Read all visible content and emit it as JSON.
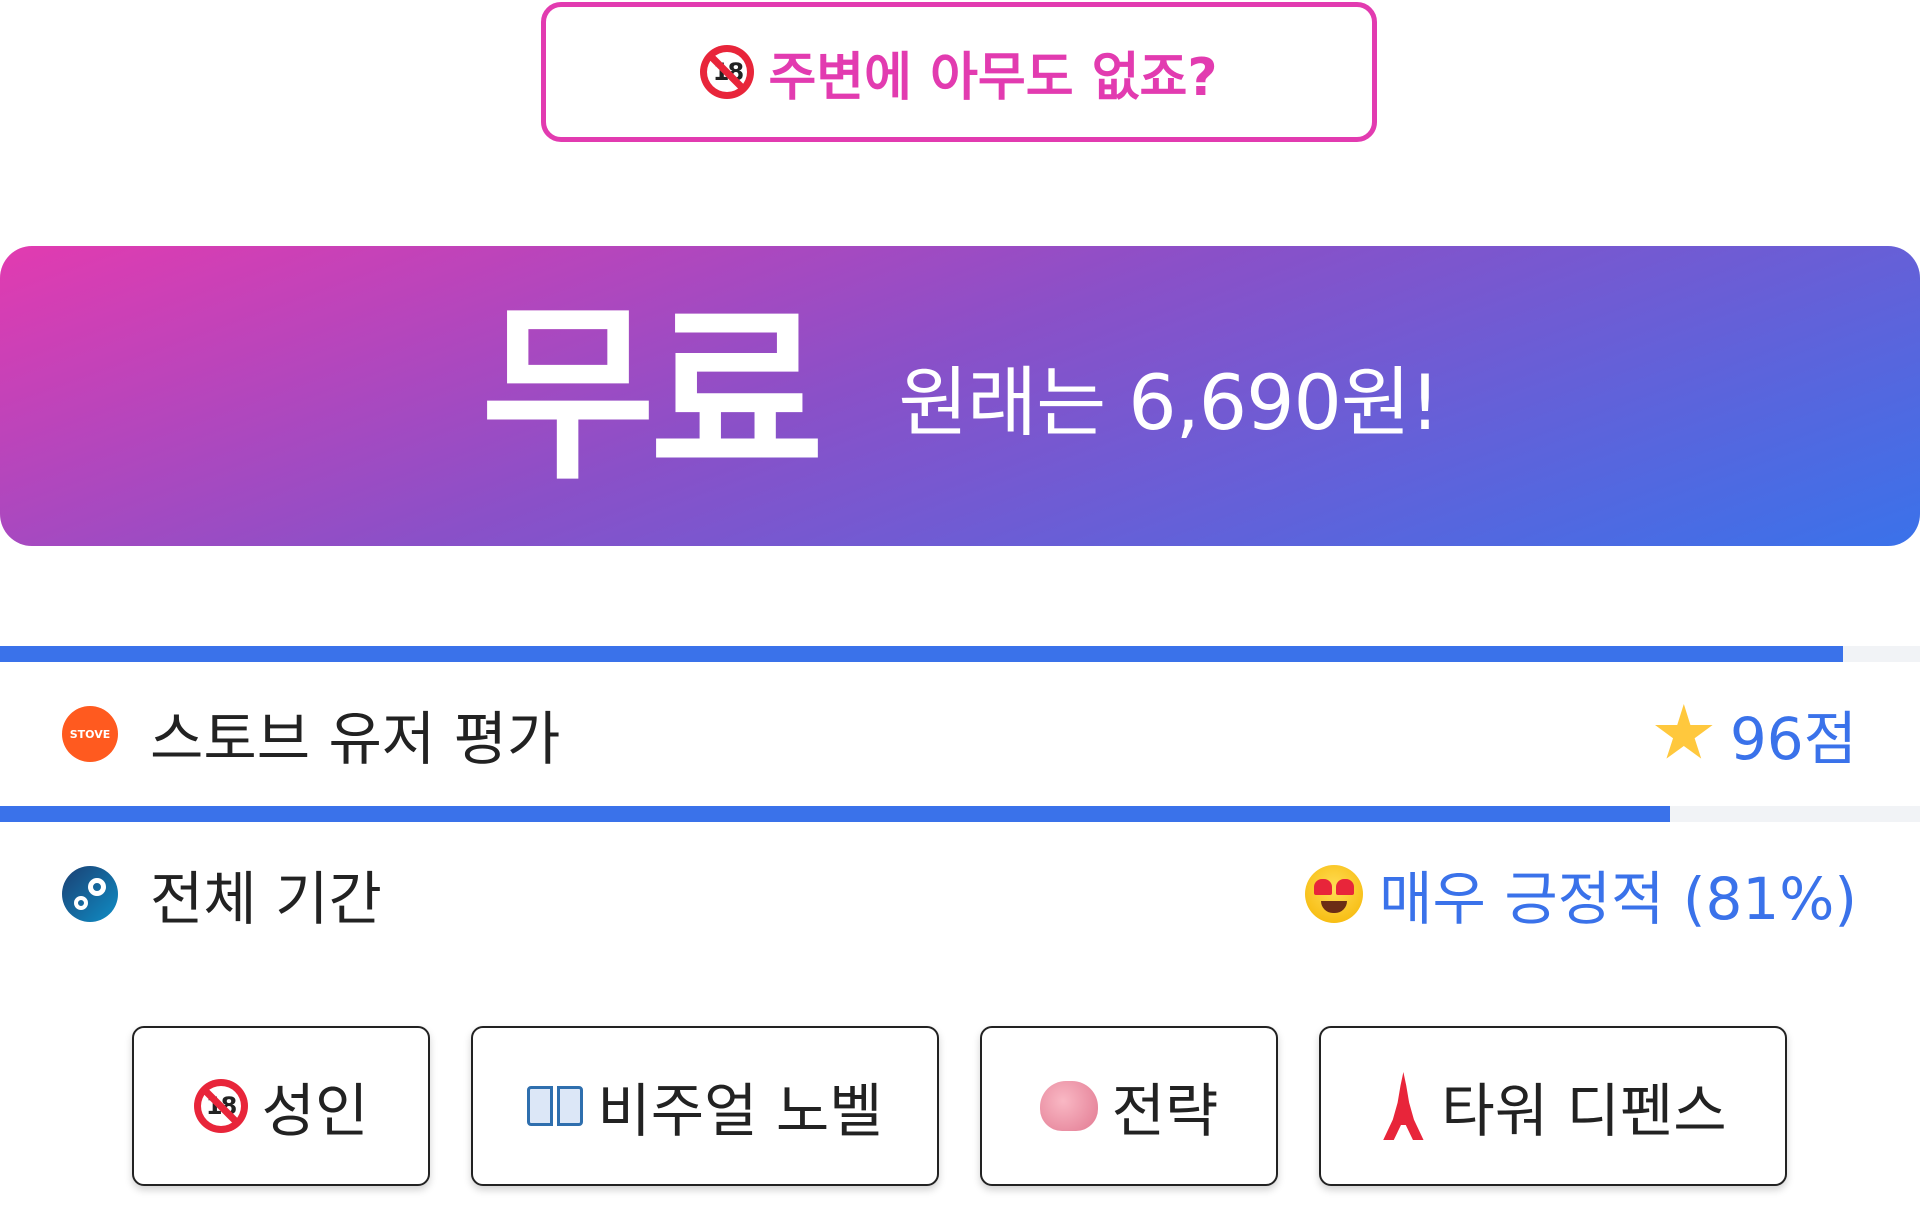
{
  "adult_banner": {
    "text": "주변에 아무도 없죠?",
    "icon": "no-under-18-icon"
  },
  "price": {
    "main": "무료",
    "original": "원래는 6,690원!"
  },
  "ratings": [
    {
      "platform_icon": "stove-icon",
      "platform_icon_text": "STOVE",
      "label": "스토브 유저 평가",
      "value_icon": "star-icon",
      "value": "96점",
      "percent": 96
    },
    {
      "platform_icon": "steam-icon",
      "label": "전체 기간",
      "value_icon": "heart-eyes-icon",
      "value": "매우 긍정적 (81%)",
      "percent": 87
    }
  ],
  "tags": [
    {
      "icon": "no-under-18-icon",
      "label": "성인"
    },
    {
      "icon": "open-book-icon",
      "label": "비주얼 노벨"
    },
    {
      "icon": "brain-icon",
      "label": "전략"
    },
    {
      "icon": "tokyo-tower-icon",
      "label": "타워 디펜스"
    }
  ],
  "colors": {
    "accent_pink": "#e23bb0",
    "accent_blue": "#3a72ea",
    "gradient_start": "#e23bb0",
    "gradient_end": "#3a72ea"
  }
}
